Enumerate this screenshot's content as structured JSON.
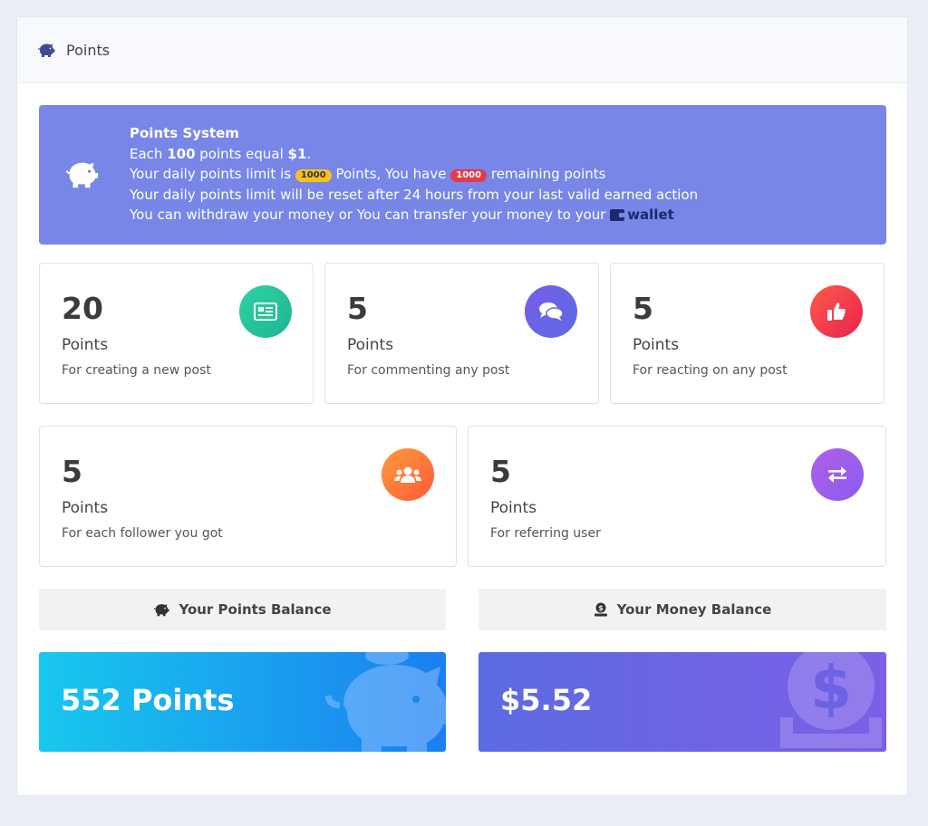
{
  "header": {
    "title": "Points",
    "icon": "piggy-bank-icon"
  },
  "alert": {
    "title": "Points System",
    "line1_pre": "Each ",
    "line1_points": "100",
    "line1_mid": " points equal ",
    "line1_money": "$1",
    "line1_end": ".",
    "line2_pre": "Your daily points limit is ",
    "daily_limit": "1000",
    "line2_mid": " Points, You have ",
    "remaining": "1000",
    "line2_end": " remaining points",
    "line3": "Your daily points limit will be reset after 24 hours from your last valid earned action",
    "line4_pre": "You can withdraw your money or You can transfer your money to your ",
    "wallet_link": "wallet",
    "color": "#7886e7"
  },
  "stats": [
    {
      "value": "20",
      "unit": "Points",
      "desc": "For creating a new post",
      "icon": "newspaper-icon",
      "colors": [
        "#2fd3a5",
        "#1fb491"
      ]
    },
    {
      "value": "5",
      "unit": "Points",
      "desc": "For commenting any post",
      "icon": "comments-icon",
      "colors": [
        "#7a5ce8",
        "#5a6be6"
      ]
    },
    {
      "value": "5",
      "unit": "Points",
      "desc": "For reacting on any post",
      "icon": "thumbs-up-icon",
      "colors": [
        "#ff5a4a",
        "#e8234f"
      ]
    },
    {
      "value": "5",
      "unit": "Points",
      "desc": "For each follower you got",
      "icon": "users-icon",
      "colors": [
        "#ff9a3c",
        "#ff5a3a"
      ]
    },
    {
      "value": "5",
      "unit": "Points",
      "desc": "For referring user",
      "icon": "exchange-icon",
      "colors": [
        "#b15fe8",
        "#8a5cf0"
      ]
    }
  ],
  "balances": {
    "points_label": "Your Points Balance",
    "points_value": "552 Points",
    "money_label": "Your Money Balance",
    "money_value": "$5.52"
  }
}
